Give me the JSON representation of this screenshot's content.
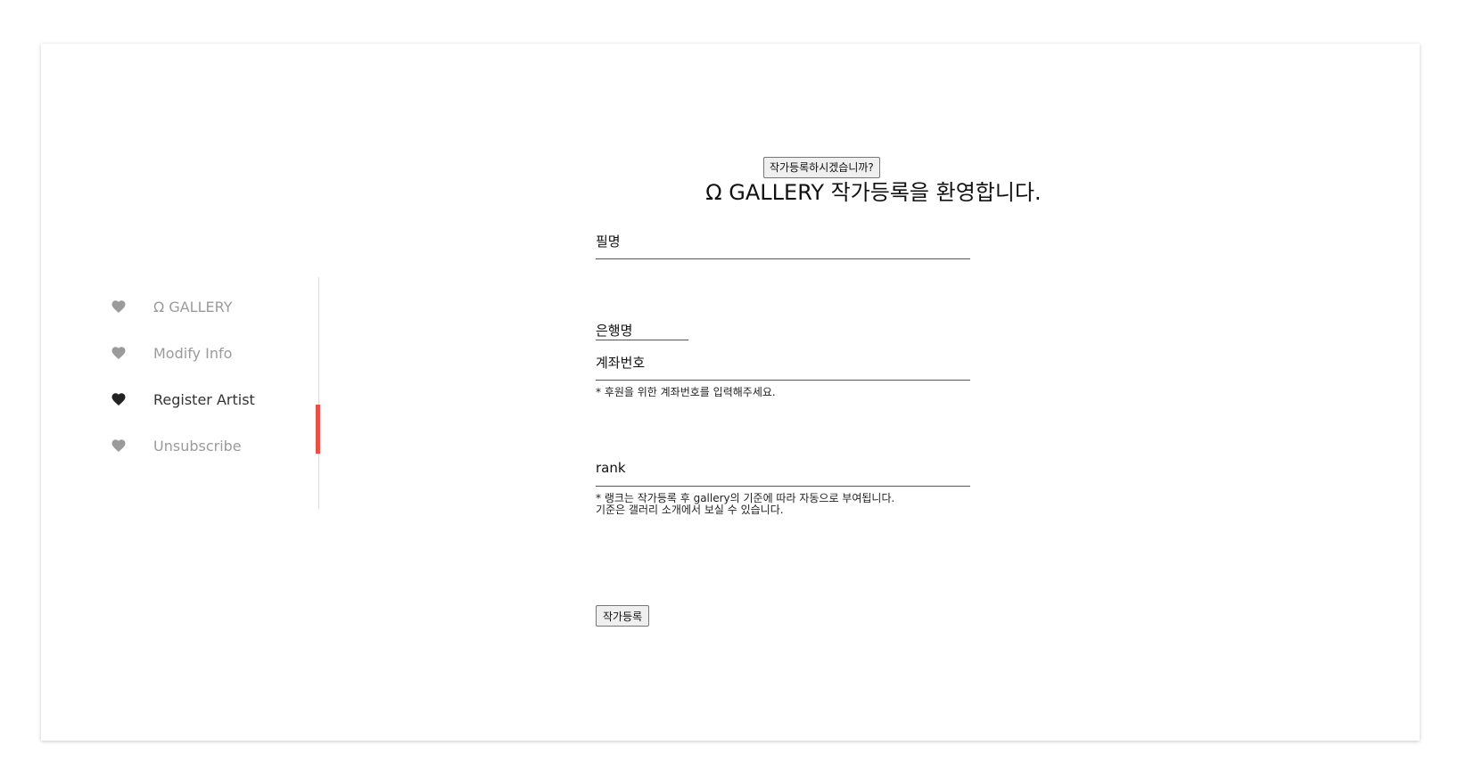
{
  "sidebar": {
    "items": [
      {
        "label": "Ω GALLERY",
        "active": false,
        "icon": "heart-icon"
      },
      {
        "label": "Modify Info",
        "active": false,
        "icon": "heart-icon"
      },
      {
        "label": "Register Artist",
        "active": true,
        "icon": "heart-icon"
      },
      {
        "label": "Unsubscribe",
        "active": false,
        "icon": "heart-icon"
      }
    ]
  },
  "colors": {
    "accent": "#e8504a",
    "heart_inactive": "#9b9b9b",
    "heart_active": "#222222"
  },
  "main": {
    "top_button_label": "작가등록하시겠습니까?",
    "title": "Ω GALLERY 작가등록을 환영합니다.",
    "fields": {
      "penname": {
        "label": "필명",
        "value": ""
      },
      "bank": {
        "label": "은행명",
        "value": ""
      },
      "account": {
        "label": "계좌번호",
        "value": "",
        "note": "* 후원을 위한 계좌번호를 입력해주세요."
      },
      "rank": {
        "label": "rank",
        "value": "",
        "note_line1": "* 랭크는 작가등록 후 gallery의 기준에 따라 자동으로 부여됩니다.",
        "note_line2": "기준은 갤러리 소개에서 보실 수 있습니다."
      }
    },
    "submit_label": "작가등록"
  }
}
